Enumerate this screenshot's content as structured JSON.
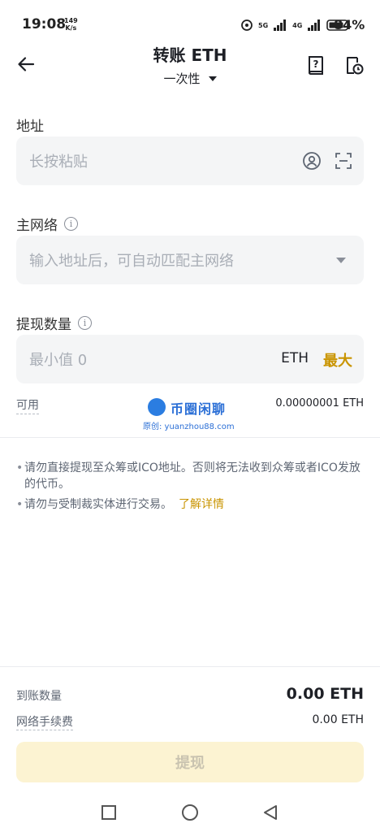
{
  "status_bar": {
    "time": "19:08",
    "net_speed_value": "149",
    "net_speed_unit": "K/s",
    "network_1": "5G",
    "network_2": "4G",
    "battery": "84%"
  },
  "header": {
    "title": "转账 ETH",
    "mode": "一次性"
  },
  "address": {
    "label": "地址",
    "placeholder": "长按粘贴"
  },
  "network": {
    "label": "主网络",
    "placeholder": "输入地址后，可自动匹配主网络"
  },
  "amount": {
    "label": "提现数量",
    "placeholder": "最小值 0",
    "unit": "ETH",
    "max_label": "最大"
  },
  "available": {
    "label": "可用",
    "value": "0.00000001 ETH"
  },
  "watermark": {
    "name": "币圈闲聊",
    "sub": "原创: yuanzhou88.com"
  },
  "notes": [
    {
      "text": "请勿直接提现至众筹或ICO地址。否则将无法收到众筹或者ICO发放的代币。",
      "link": ""
    },
    {
      "text": "请勿与受制裁实体进行交易。",
      "link": "了解详情"
    }
  ],
  "summary": {
    "receive_label": "到账数量",
    "receive_value": "0.00 ETH",
    "fee_label": "网络手续费",
    "fee_value": "0.00 ETH"
  },
  "submit_label": "提现",
  "colors": {
    "accent": "#c99400",
    "button_disabled_bg": "#fcf3d2",
    "field_bg": "#f4f5f6"
  }
}
